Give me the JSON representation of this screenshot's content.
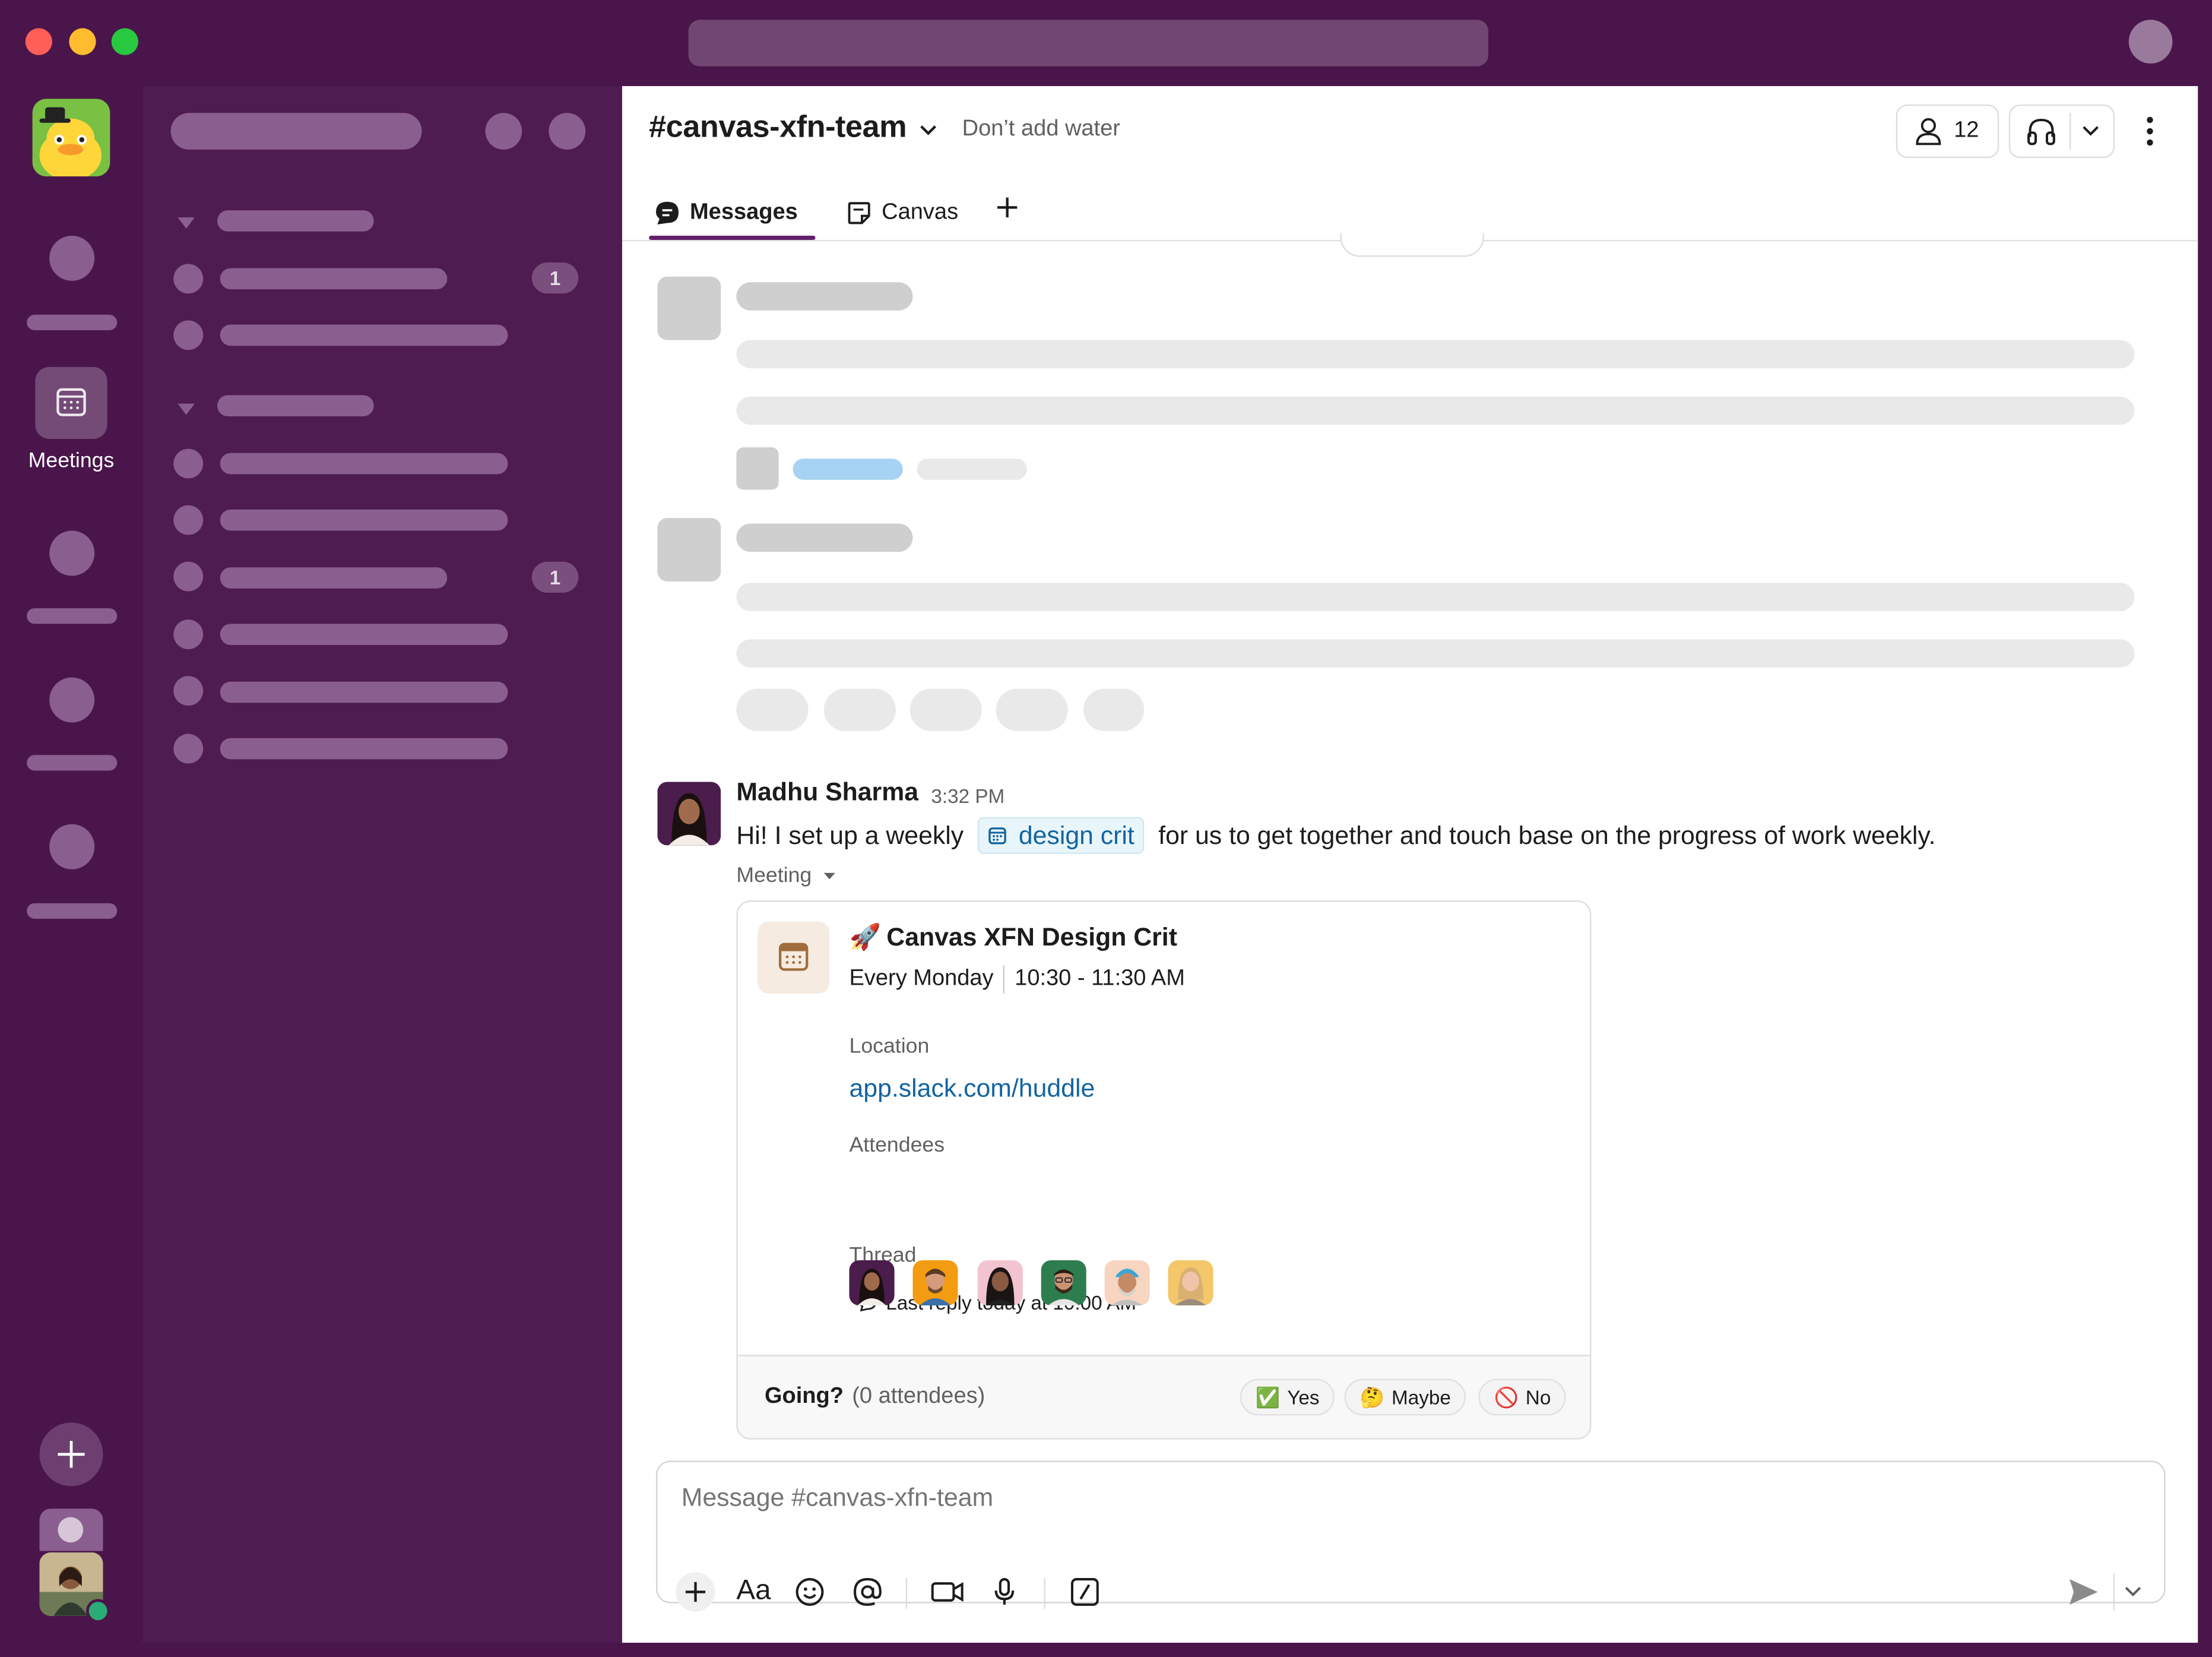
{
  "workspace_rail": {
    "meetings_label": "Meetings"
  },
  "sidebar": {
    "badges": [
      "1",
      "1"
    ]
  },
  "channel": {
    "name": "#canvas-xfn-team",
    "topic": "Don’t add water",
    "member_count": "12",
    "tabs": [
      {
        "label": "Messages"
      },
      {
        "label": "Canvas"
      }
    ]
  },
  "message": {
    "author": "Madhu Sharma",
    "time": "3:32 PM",
    "text_before": "Hi! I set up a weekly",
    "link_chip": "design crit",
    "text_after": "for us to get together and touch base on the progress of work weekly.",
    "attachment_label": "Meeting"
  },
  "meeting_card": {
    "title": "Canvas XFN Design Crit",
    "title_emoji": "🚀",
    "recurrence": "Every Monday",
    "time_range": "10:30 - 11:30 AM",
    "location_label": "Location",
    "location_link": "app.slack.com/huddle",
    "attendees_label": "Attendees",
    "attendee_count_shown": 6,
    "thread_label": "Thread",
    "thread_reply": "Last reply today at 10:00 AM",
    "going_label": "Going?",
    "going_count": "(0 attendees)",
    "rsvp": [
      {
        "emoji": "✅",
        "label": "Yes"
      },
      {
        "emoji": "🤔",
        "label": "Maybe"
      },
      {
        "emoji": "🚫",
        "label": "No"
      }
    ]
  },
  "composer": {
    "placeholder": "Message #canvas-xfn-team",
    "format_label": "Aa"
  },
  "colors": {
    "aubergine": "#4a154b",
    "sidebar": "#4f1c51",
    "link": "#1264a3",
    "tab_active": "#611f69"
  }
}
